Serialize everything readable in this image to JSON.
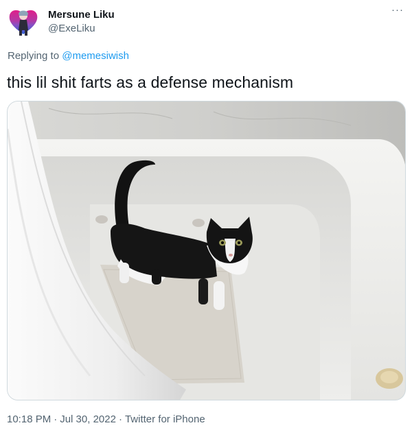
{
  "author": {
    "name": "Mersune Liku",
    "handle": "@ExeLiku"
  },
  "more_icon": "more-horizontal-icon",
  "reply": {
    "prefix": "Replying to",
    "mention": "@memesiwish"
  },
  "tweet": {
    "text": "this lil shit farts as a defense mechanism"
  },
  "meta": {
    "time": "10:18 PM",
    "date": "Jul 30, 2022",
    "source": "Twitter for iPhone",
    "separator": "·"
  },
  "colors": {
    "link": "#1d9bf0",
    "muted": "#536471",
    "text": "#0f1419"
  }
}
